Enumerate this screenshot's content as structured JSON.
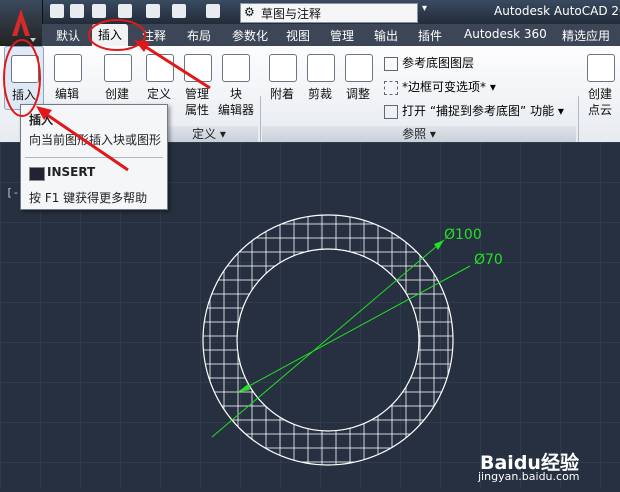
{
  "quick_access": {
    "workspace": "草图与注释"
  },
  "app_title": "Autodesk AutoCAD 20",
  "tabs": [
    "默认",
    "插入",
    "注释",
    "布局",
    "参数化",
    "视图",
    "管理",
    "输出",
    "插件",
    "Autodesk 360",
    "精选应用"
  ],
  "ribbon": {
    "insert_label": "插入",
    "edit_label": "编辑",
    "create_label": "创建",
    "define_label": "定义",
    "manage_label": "管理",
    "manage_label2": "属性",
    "block_editor_label": "块",
    "block_editor_label2": "编辑器",
    "attach_label": "附着",
    "clip_label": "剪裁",
    "adjust_label": "调整",
    "underlay_layers": "参考底图图层",
    "frames_variable": "*边框可变选项*",
    "snap_underlay": "打开 “捕捉到参考底图” 功能",
    "create_cloud_label": "创建",
    "create_cloud_label2": "点云",
    "panel_reference": "参照",
    "panel_block_def_tail": "定义"
  },
  "tooltip": {
    "title": "插入",
    "description": "向当前图形插入块或图形",
    "command": "INSERT",
    "help": "按 F1 键获得更多帮助"
  },
  "drawing": {
    "dim_outer": "Ø100",
    "dim_inner": "Ø70"
  },
  "watermark": {
    "brand": "Baidu经验",
    "url": "jingyan.baidu.com"
  }
}
